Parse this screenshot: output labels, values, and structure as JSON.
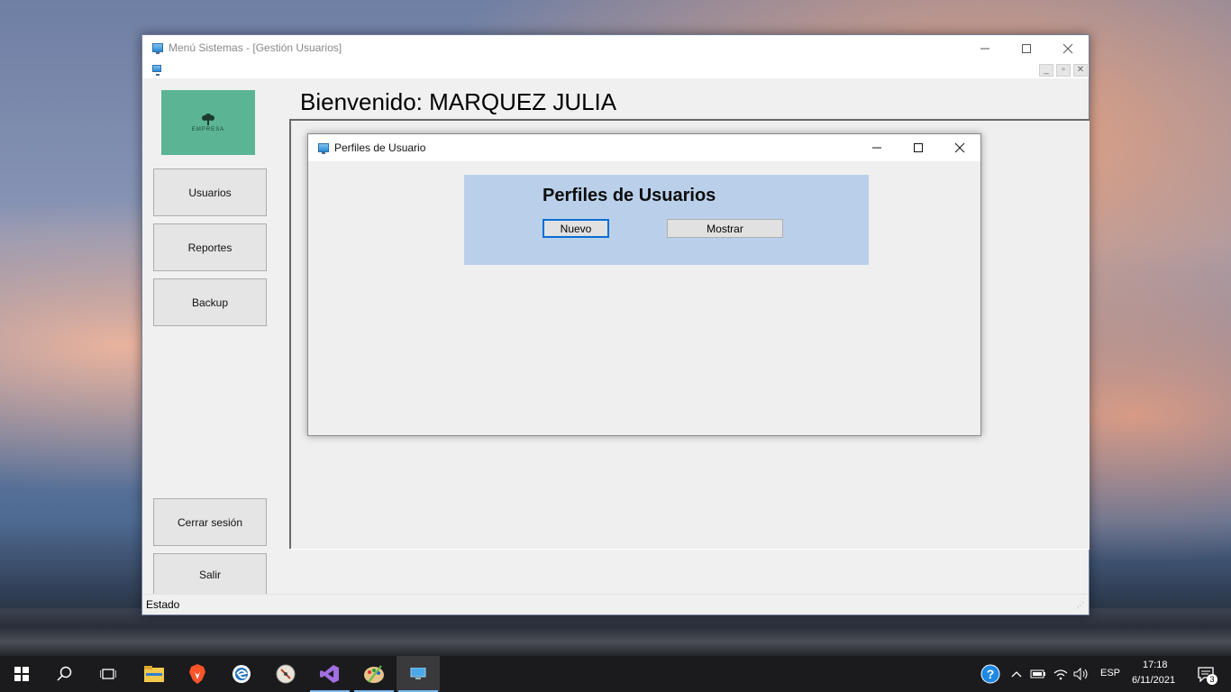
{
  "window": {
    "title": "Menú Sistemas - [Gestión Usuarios]",
    "minimize": "—",
    "maximize": "☐",
    "close": "✕"
  },
  "sidebar": {
    "logo_text": "EMPRESA",
    "buttons": [
      "Usuarios",
      "Reportes",
      "Backup",
      "Cerrar sesión",
      "Salir"
    ]
  },
  "header": {
    "welcome": "Bienvenido: MARQUEZ JULIA"
  },
  "status": {
    "text": "Estado"
  },
  "child_window": {
    "title": "Perfiles de Usuario",
    "heading": "Perfiles de Usuarios",
    "new_button": "Nuevo",
    "show_button": "Mostrar"
  },
  "taskbar": {
    "apps": [
      "windows-start",
      "search",
      "task-view",
      "file-explorer",
      "brave",
      "edge",
      "compass",
      "visual-studio",
      "paint",
      "app"
    ],
    "language": "ESP",
    "time": "17:18",
    "date": "6/11/2021",
    "notifications": "3"
  }
}
